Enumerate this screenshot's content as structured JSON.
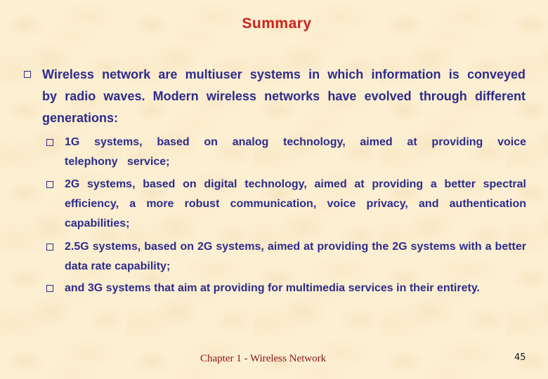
{
  "slide": {
    "title": "Summary",
    "main_bullet": {
      "icon": "hollow-square-bullet",
      "text": "Wireless network are multiuser systems in which information is conveyed by radio waves. Modern wireless networks have evolved through different generations:"
    },
    "sub_bullets": [
      {
        "icon": "hollow-square-bullet",
        "text": "1G systems, based on analog technology, aimed at providing voice telephony service;"
      },
      {
        "icon": "hollow-square-bullet",
        "text": "2G systems, based on digital technology, aimed at providing a better spectral efficiency, a more robust communication, voice privacy, and authentication capabilities;"
      },
      {
        "icon": "hollow-square-bullet",
        "text": "2.5G systems, based on 2G systems, aimed at providing the 2G systems with a better data rate capability;"
      },
      {
        "icon": "hollow-square-bullet",
        "text": "and 3G systems that aim at providing for multimedia services in their entirety."
      }
    ],
    "footer": "Chapter 1 - Wireless Network",
    "page_number": "45"
  },
  "colors": {
    "title": "#d0201e",
    "body_text": "#2e2c8c",
    "footer": "#8a1616",
    "background": "#fcefd2"
  }
}
